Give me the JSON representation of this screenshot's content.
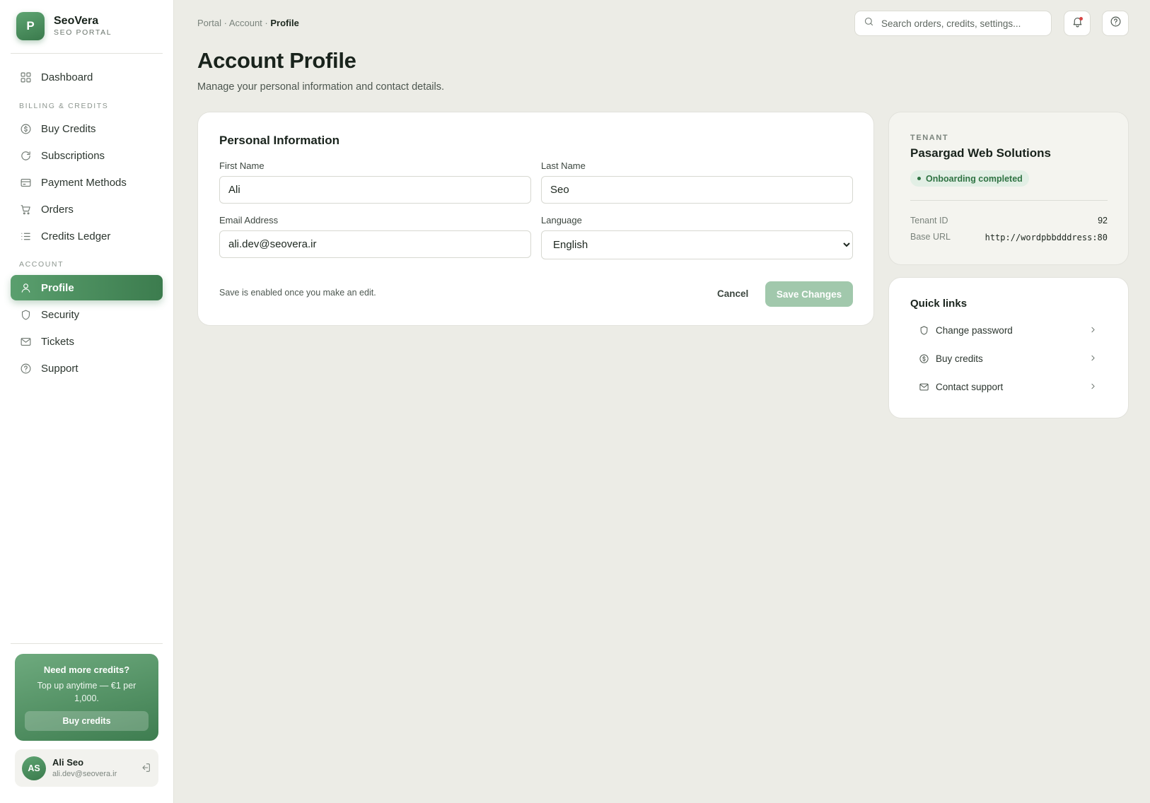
{
  "brand": {
    "logo_letter": "P",
    "name": "SeoVera",
    "subtitle": "SEO PORTAL"
  },
  "sidebar": {
    "dashboard": {
      "label": "Dashboard",
      "icon": "grid-icon"
    },
    "sections": [
      {
        "title": "BILLING & CREDITS"
      },
      {
        "title": "ACCOUNT"
      }
    ],
    "billing_items": [
      {
        "label": "Buy Credits",
        "icon": "coin-icon"
      },
      {
        "label": "Subscriptions",
        "icon": "refresh-icon"
      },
      {
        "label": "Payment Methods",
        "icon": "credit-card-icon"
      },
      {
        "label": "Orders",
        "icon": "cart-icon"
      },
      {
        "label": "Credits Ledger",
        "icon": "list-icon"
      }
    ],
    "account_items": [
      {
        "label": "Profile",
        "icon": "user-icon",
        "active": true
      },
      {
        "label": "Security",
        "icon": "shield-icon"
      },
      {
        "label": "Tickets",
        "icon": "mail-icon"
      },
      {
        "label": "Support",
        "icon": "help-circle-icon"
      }
    ],
    "promo": {
      "title": "Need more credits?",
      "text": "Top up anytime — €1 per 1,000.",
      "button": "Buy credits"
    },
    "user": {
      "initials": "AS",
      "name": "Ali Seo",
      "email": "ali.dev@seovera.ir"
    }
  },
  "header": {
    "breadcrumb": {
      "portal": "Portal",
      "sep": " · ",
      "account": "Account",
      "current": "Profile"
    },
    "search_placeholder": "Search orders, credits, settings..."
  },
  "page": {
    "title": "Account Profile",
    "subtitle": "Manage your personal information and contact details."
  },
  "personal_info": {
    "title": "Personal Information",
    "first_name": {
      "label": "First Name",
      "value": "Ali"
    },
    "last_name": {
      "label": "Last Name",
      "value": "Seo"
    },
    "email": {
      "label": "Email Address",
      "value": "ali.dev@seovera.ir"
    },
    "language": {
      "label": "Language",
      "value": "English"
    },
    "hint": "Save is enabled once you make an edit.",
    "cancel_label": "Cancel",
    "save_label": "Save Changes"
  },
  "tenant": {
    "label": "TENANT",
    "name": "Pasargad Web Solutions",
    "status": "Onboarding completed",
    "id_label": "Tenant ID",
    "id_value": "92",
    "url_label": "Base URL",
    "url_value": "http://wordpbbdddress:80"
  },
  "quick_links": {
    "title": "Quick links",
    "items": [
      {
        "label": "Change password",
        "icon": "shield-icon"
      },
      {
        "label": "Buy credits",
        "icon": "coin-icon"
      },
      {
        "label": "Contact support",
        "icon": "mail-icon"
      }
    ]
  },
  "colors": {
    "accent": "#3c7c4e",
    "accent_light": "#5a9f6e",
    "background": "#ecece6",
    "notification_dot": "#d64545"
  }
}
